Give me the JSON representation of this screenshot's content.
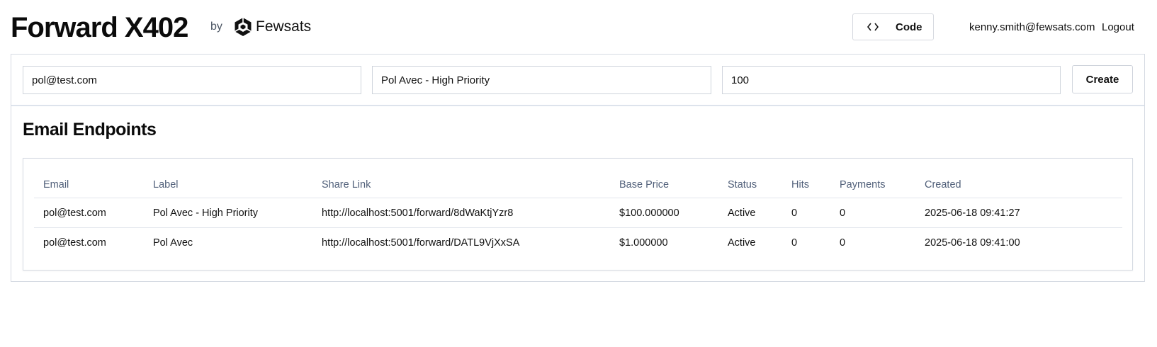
{
  "header": {
    "title": "Forward X402",
    "by_label": "by",
    "brand_name": "Fewsats",
    "code_button_label": "Code",
    "user_email": "kenny.smith@fewsats.com",
    "logout_label": "Logout"
  },
  "form": {
    "email_value": "pol@test.com",
    "label_value": "Pol Avec - High Priority",
    "price_value": "100",
    "create_label": "Create"
  },
  "endpoints": {
    "title": "Email Endpoints",
    "columns": [
      "Email",
      "Label",
      "Share Link",
      "Base Price",
      "Status",
      "Hits",
      "Payments",
      "Created"
    ],
    "rows": [
      {
        "email": "pol@test.com",
        "label": "Pol Avec - High Priority",
        "share_link": "http://localhost:5001/forward/8dWaKtjYzr8",
        "base_price": "$100.000000",
        "status": "Active",
        "hits": "0",
        "payments": "0",
        "created": "2025-06-18 09:41:27"
      },
      {
        "email": "pol@test.com",
        "label": "Pol Avec",
        "share_link": "http://localhost:5001/forward/DATL9VjXxSA",
        "base_price": "$1.000000",
        "status": "Active",
        "hits": "0",
        "payments": "0",
        "created": "2025-06-18 09:41:00"
      }
    ]
  },
  "icons": {
    "brand_logo": "fewsats-logo-icon",
    "code": "code-brackets-icon"
  }
}
